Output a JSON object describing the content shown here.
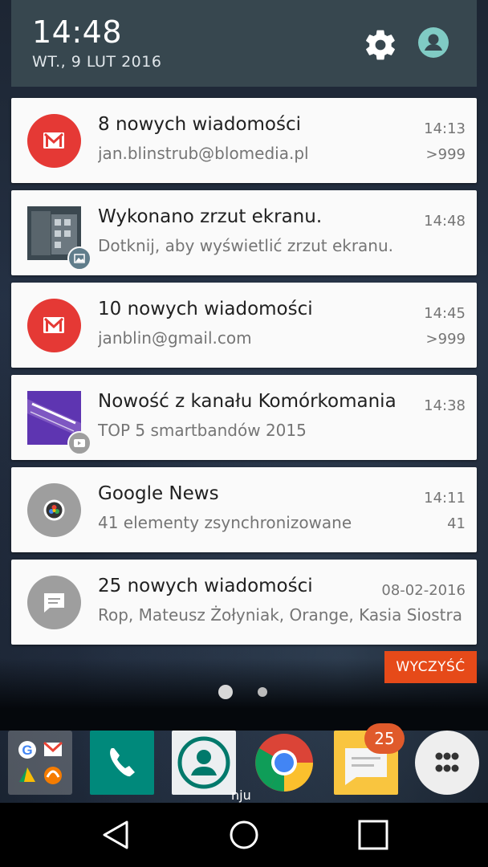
{
  "header": {
    "time": "14:48",
    "date": "WT., 9 LUT 2016"
  },
  "notifications": [
    {
      "title": "8 nowych wiadomości",
      "subtitle": "jan.blinstrub@blomedia.pl",
      "time": "14:13",
      "count": ">999",
      "icon": "gmail-icon"
    },
    {
      "title": "Wykonano zrzut ekranu.",
      "subtitle": "Dotknij, aby wyświetlić zrzut ekranu.",
      "time": "14:48",
      "count": "",
      "icon": "screenshot-thumbnail"
    },
    {
      "title": "10 nowych wiadomości",
      "subtitle": "janblin@gmail.com",
      "time": "14:45",
      "count": ">999",
      "icon": "gmail-icon"
    },
    {
      "title": "Nowość z kanału Komórkomania",
      "subtitle": "TOP 5 smartbandów 2015",
      "time": "14:38",
      "count": "",
      "icon": "youtube-thumbnail"
    },
    {
      "title": "Google News",
      "subtitle": "41 elementy zsynchronizowane",
      "time": "14:11",
      "count": "41",
      "icon": "google-news-icon"
    },
    {
      "title": "25 nowych wiadomości",
      "subtitle": "Rop, Mateusz Żołyniak, Orange, Kasia Siostra",
      "time": "08-02-2016",
      "count": "",
      "icon": "messages-icon"
    }
  ],
  "clear_button": "WYCZYŚĆ",
  "dock": {
    "badge": "25",
    "label": "nju"
  },
  "colors": {
    "header_bg": "#37474f",
    "gmail_red": "#e53935",
    "clear_orange": "#e64a19",
    "grey_icon": "#9e9e9e"
  }
}
